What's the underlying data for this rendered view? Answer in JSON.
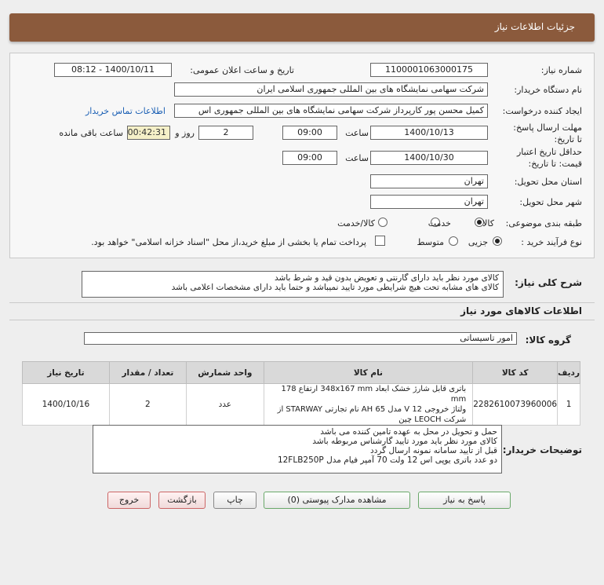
{
  "header": {
    "title": "جزئیات اطلاعات نیاز"
  },
  "form": {
    "need_number_label": "شماره نیاز:",
    "need_number": "1100001063000175",
    "announce_label": "تاریخ و ساعت اعلان عمومی:",
    "announce_value": "1400/10/11 - 08:12",
    "buyer_org_label": "نام دستگاه خریدار:",
    "buyer_org": "شرکت سهامی نمایشگاه های بین المللی جمهوری اسلامی ایران",
    "requester_label": "ایجاد کننده درخواست:",
    "requester": "کمیل محسن پور کارپرداز شرکت سهامی نمایشگاه های بین المللی جمهوری اس",
    "contact_link": "اطلاعات تماس خریدار",
    "deadline_label": "مهلت ارسال پاسخ: تا تاریخ:",
    "deadline_date": "1400/10/13",
    "deadline_time_label": "ساعت",
    "deadline_time": "09:00",
    "days_remaining": "2",
    "days_label": "روز و",
    "time_remaining": "00:42:31",
    "remaining_label": "ساعت باقی مانده",
    "validity_label": "حداقل تاریخ اعتبار قیمت: تا تاریخ:",
    "validity_date": "1400/10/30",
    "validity_time_label": "ساعت",
    "validity_time": "09:00",
    "province_label": "استان محل تحویل:",
    "province": "تهران",
    "city_label": "شهر محل تحویل:",
    "city": "تهران",
    "category_label": "طبقه بندی موضوعی:",
    "category_options": [
      "کالا",
      "خدمت",
      "کالا/خدمت"
    ],
    "category_selected": "کالا",
    "process_label": "نوع فرآیند خرید :",
    "process_options": [
      "جزیی",
      "متوسط"
    ],
    "process_selected": "جزیی",
    "payment_note": "پرداخت تمام یا بخشی از مبلغ خرید،از محل \"اسناد خزانه اسلامی\" خواهد بود."
  },
  "general_desc": {
    "label": "شرح کلی نیاز:",
    "lines": [
      "کالای مورد نظر باید دارای گارنتی و تعویض بدون قید و شرط باشد",
      "کالای های مشابه تحت هیچ شرایطی مورد تایید نمیباشد و حتما باید دارای مشخصات اعلامی باشد"
    ]
  },
  "goods_section": {
    "title": "اطلاعات کالاهای مورد نیاز",
    "group_label": "گروه کالا:",
    "group_value": "امور تاسیساتی"
  },
  "table": {
    "headers": [
      "ردیف",
      "کد کالا",
      "نام کالا",
      "واحد شمارش",
      "تعداد / مقدار",
      "تاریخ نیاز"
    ],
    "rows": [
      {
        "row": "1",
        "code": "2282610073960006",
        "name_lines": [
          "باتری قابل شارژ خشک ابعاد 348x167 mm ارتفاع 178 mm",
          "ولتاژ خروجی V 12 مدل AH 65 نام تجارتی STARWAY از",
          "شرکت LEOCH چین"
        ],
        "unit": "عدد",
        "qty": "2",
        "date": "1400/10/16"
      }
    ]
  },
  "buyer_notes": {
    "label": "توضیحات خریدار:",
    "lines": [
      "حمل و تحویل در محل به عهده تامین کننده می باشد",
      "کالای مورد نظر باید مورد تایید گارشناس مربوطه باشد",
      "قبل از تایید سامانه نمونه ارسال گردد",
      "دو عدد باتری یوپی اس 12 ولت 70 آمپر فیام مدل 12FLB250P"
    ]
  },
  "buttons": {
    "respond": "پاسخ به نیاز",
    "attachments": "مشاهده مدارک پیوستی (0)",
    "print": "چاپ",
    "back": "بازگشت",
    "exit": "خروج"
  }
}
